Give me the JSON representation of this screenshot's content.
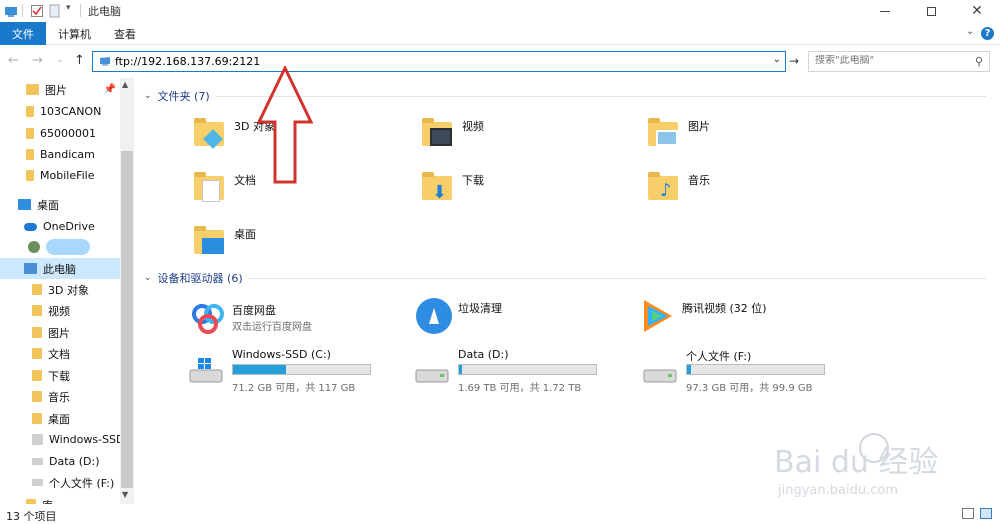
{
  "window": {
    "title": "此电脑",
    "minimize_icon": "minimize-icon",
    "maximize_icon": "maximize-icon",
    "close_icon": "close-icon"
  },
  "ribbon": {
    "tabs": [
      "文件",
      "计算机",
      "查看"
    ],
    "collapse_icon": "chevron-down-icon",
    "help_label": "?"
  },
  "address_bar": {
    "back_icon": "back-arrow-icon",
    "forward_icon": "forward-arrow-icon",
    "recent_icon": "chevron-down-icon",
    "up_icon": "up-arrow-icon",
    "value": "ftp://192.168.137.69:2121",
    "search_placeholder": "搜索\"此电脑\""
  },
  "sidebar": {
    "items": [
      {
        "label": "图片",
        "icon": "picture-folder-icon",
        "pinned": true
      },
      {
        "label": "103CANON",
        "icon": "folder-icon"
      },
      {
        "label": "65000001",
        "icon": "folder-icon"
      },
      {
        "label": "Bandicam",
        "icon": "folder-icon"
      },
      {
        "label": "MobileFile",
        "icon": "folder-icon"
      },
      {
        "label": "桌面",
        "icon": "desktop-icon"
      },
      {
        "label": "OneDrive",
        "icon": "cloud-icon"
      },
      {
        "label": "",
        "icon": "user-icon"
      },
      {
        "label": "此电脑",
        "icon": "this-pc-icon",
        "selected": true
      },
      {
        "label": "3D 对象",
        "icon": "3d-objects-icon"
      },
      {
        "label": "视频",
        "icon": "video-folder-icon"
      },
      {
        "label": "图片",
        "icon": "picture-folder-icon"
      },
      {
        "label": "文档",
        "icon": "document-folder-icon"
      },
      {
        "label": "下载",
        "icon": "download-folder-icon"
      },
      {
        "label": "音乐",
        "icon": "music-folder-icon"
      },
      {
        "label": "桌面",
        "icon": "desktop-folder-icon"
      },
      {
        "label": "Windows-SSD",
        "icon": "windows-drive-icon"
      },
      {
        "label": "Data (D:)",
        "icon": "drive-icon"
      },
      {
        "label": "个人文件 (F:)",
        "icon": "drive-icon"
      },
      {
        "label": "库",
        "icon": "library-icon"
      }
    ]
  },
  "folders_group": {
    "header": "文件夹 (7)",
    "items": [
      {
        "label": "3D 对象",
        "icon": "3d-objects-icon"
      },
      {
        "label": "视频",
        "icon": "video-folder-icon"
      },
      {
        "label": "图片",
        "icon": "picture-folder-icon"
      },
      {
        "label": "文档",
        "icon": "document-folder-icon"
      },
      {
        "label": "下载",
        "icon": "download-folder-icon"
      },
      {
        "label": "音乐",
        "icon": "music-folder-icon"
      },
      {
        "label": "桌面",
        "icon": "desktop-folder-icon"
      }
    ]
  },
  "devices_group": {
    "header": "设备和驱动器 (6)",
    "apps": [
      {
        "name": "百度网盘",
        "desc": "双击运行百度网盘",
        "icon": "baidu-netdisk-icon"
      },
      {
        "name": "垃圾清理",
        "desc": "",
        "icon": "cleanup-broom-icon"
      },
      {
        "name": "腾讯视频 (32 位)",
        "desc": "",
        "icon": "tencent-video-icon"
      }
    ],
    "drives": [
      {
        "name": "Windows-SSD (C:)",
        "info": "71.2 GB 可用，共 117 GB",
        "used_fraction": 0.39,
        "icon": "windows-drive-icon"
      },
      {
        "name": "Data (D:)",
        "info": "1.69 TB 可用，共 1.72 TB",
        "used_fraction": 0.02,
        "icon": "drive-icon"
      },
      {
        "name": "个人文件 (F:)",
        "info": "97.3 GB 可用，共 99.9 GB",
        "used_fraction": 0.03,
        "icon": "drive-icon"
      }
    ]
  },
  "status_bar": {
    "count": "13 个项目",
    "details_view_icon": "details-view-icon",
    "large_icons_view_icon": "large-icons-view-icon"
  },
  "annotation": {
    "color": "#d0342c",
    "icon": "red-up-arrow-icon"
  },
  "watermark": {
    "text": "Bai du 经验",
    "url": "jingyan.baidu.com"
  },
  "colors": {
    "accent": "#1979ca",
    "selection": "#cce8ff",
    "drive_fill": "#26a0da",
    "group_header": "#1e3e86"
  }
}
